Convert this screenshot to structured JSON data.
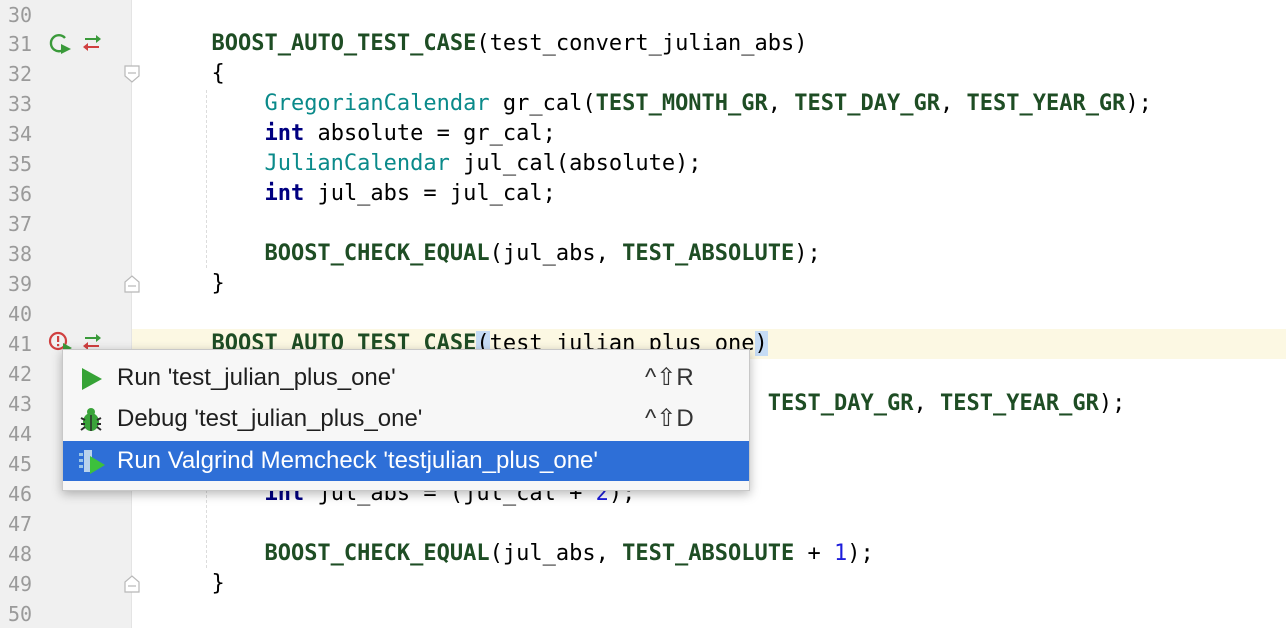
{
  "gutter": {
    "line_numbers": [
      "30",
      "31",
      "32",
      "33",
      "34",
      "35",
      "36",
      "37",
      "38",
      "39",
      "40",
      "41",
      "42",
      "43",
      "44",
      "45",
      "46",
      "47",
      "48",
      "49",
      "50"
    ]
  },
  "code": {
    "l31": {
      "macro": "BOOST_AUTO_TEST_CASE",
      "args": "(test_convert_julian_abs)"
    },
    "l32": "{",
    "l33": {
      "type": "GregorianCalendar",
      "var": " gr_cal(",
      "a1": "TEST_MONTH_GR",
      "sep1": ", ",
      "a2": "TEST_DAY_GR",
      "sep2": ", ",
      "a3": "TEST_YEAR_GR",
      "end": ");"
    },
    "l34": {
      "kw": "int",
      "rest": " absolute = gr_cal;"
    },
    "l35": {
      "type": "JulianCalendar",
      "rest": " jul_cal(absolute);"
    },
    "l36": {
      "kw": "int",
      "rest": " jul_abs = jul_cal;"
    },
    "l38": {
      "macro": "BOOST_CHECK_EQUAL",
      "open": "(jul_abs, ",
      "const": "TEST_ABSOLUTE",
      "close": ");"
    },
    "l39": "}",
    "l41": {
      "macro": "BOOST_AUTO_TEST_CASE",
      "open": "(",
      "name": "test_julian_plus_one",
      "close": ")"
    },
    "l43": {
      "a2": "TEST_DAY_GR",
      "sep": ", ",
      "a3": "TEST_YEAR_GR",
      "end": ");"
    },
    "l46": {
      "kw": "int",
      "rest": " jul_abs = (jul_cal + ",
      "num": "2",
      "end": ");"
    },
    "l48": {
      "macro": "BOOST_CHECK_EQUAL",
      "open": "(jul_abs, ",
      "const": "TEST_ABSOLUTE",
      "plus": " + ",
      "num": "1",
      "close": ");"
    },
    "l49": "}"
  },
  "popup": {
    "items": [
      {
        "label": "Run 'test_julian_plus_one'",
        "shortcut": "^⇧R",
        "icon": "run-icon"
      },
      {
        "label": "Debug 'test_julian_plus_one'",
        "shortcut": "^⇧D",
        "icon": "debug-icon"
      },
      {
        "label": "Run Valgrind Memcheck 'testjulian_plus_one'",
        "shortcut": "",
        "icon": "valgrind-icon"
      }
    ],
    "selected_index": 2
  },
  "colors": {
    "keyword": "#000080",
    "macro": "#1e4d24",
    "class_name": "#0a8a8a",
    "number": "#1d1ddb",
    "current_line": "#fcf8e3",
    "selection": "#2e6fd7",
    "gutter_bg": "#f0f0f0"
  }
}
